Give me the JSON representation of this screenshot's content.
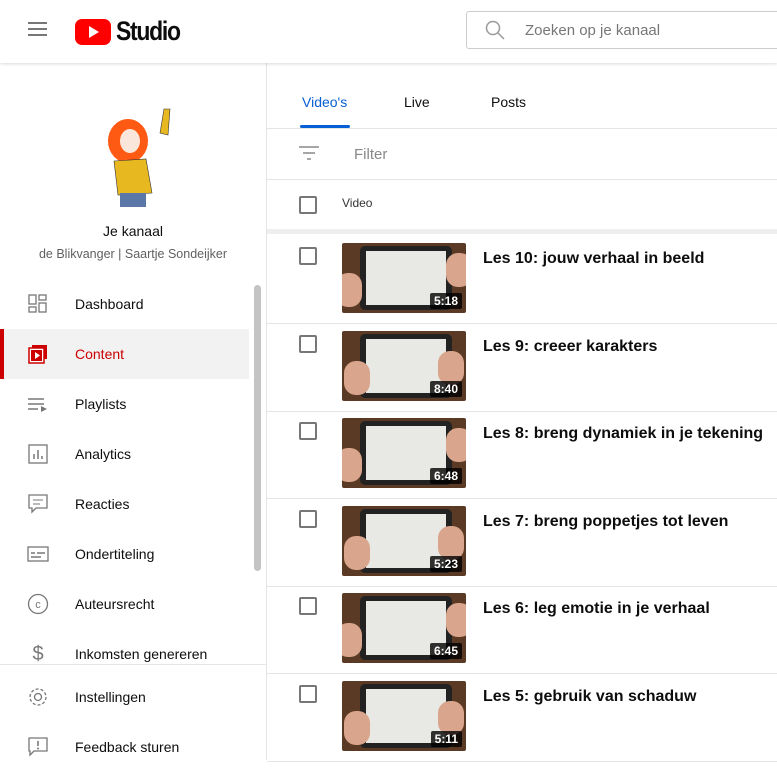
{
  "header": {
    "logo_text": "Studio",
    "search_placeholder": "Zoeken op je kanaal"
  },
  "channel": {
    "title": "Je kanaal",
    "name": "de Blikvanger | Saartje Sondeijker"
  },
  "sidebar": {
    "items": [
      {
        "label": "Dashboard",
        "icon": "dashboard-icon"
      },
      {
        "label": "Content",
        "icon": "content-icon",
        "active": true
      },
      {
        "label": "Playlists",
        "icon": "playlists-icon"
      },
      {
        "label": "Analytics",
        "icon": "analytics-icon"
      },
      {
        "label": "Reacties",
        "icon": "comments-icon"
      },
      {
        "label": "Ondertiteling",
        "icon": "subtitles-icon"
      },
      {
        "label": "Auteursrecht",
        "icon": "copyright-icon"
      },
      {
        "label": "Inkomsten genereren",
        "icon": "dollar-icon"
      }
    ],
    "bottom": [
      {
        "label": "Instellingen",
        "icon": "gear-icon"
      },
      {
        "label": "Feedback sturen",
        "icon": "feedback-icon"
      }
    ]
  },
  "tabs": [
    {
      "label": "Video's",
      "active": true
    },
    {
      "label": "Live"
    },
    {
      "label": "Posts"
    }
  ],
  "filter": {
    "placeholder": "Filter"
  },
  "table": {
    "column": "Video",
    "rows": [
      {
        "title": "Les 10: jouw verhaal in beeld",
        "duration": "5:18"
      },
      {
        "title": "Les 9: creeer karakters",
        "duration": "8:40"
      },
      {
        "title": "Les 8: breng dynamiek in je tekening",
        "duration": "6:48"
      },
      {
        "title": "Les 7: breng poppetjes tot leven",
        "duration": "5:23"
      },
      {
        "title": "Les 6: leg emotie in je verhaal",
        "duration": "6:45"
      },
      {
        "title": "Les 5: gebruik van schaduw",
        "duration": "5:11"
      }
    ]
  },
  "colors": {
    "accent": "#065fd4",
    "active": "#cc0000",
    "brand": "#ff0000"
  }
}
